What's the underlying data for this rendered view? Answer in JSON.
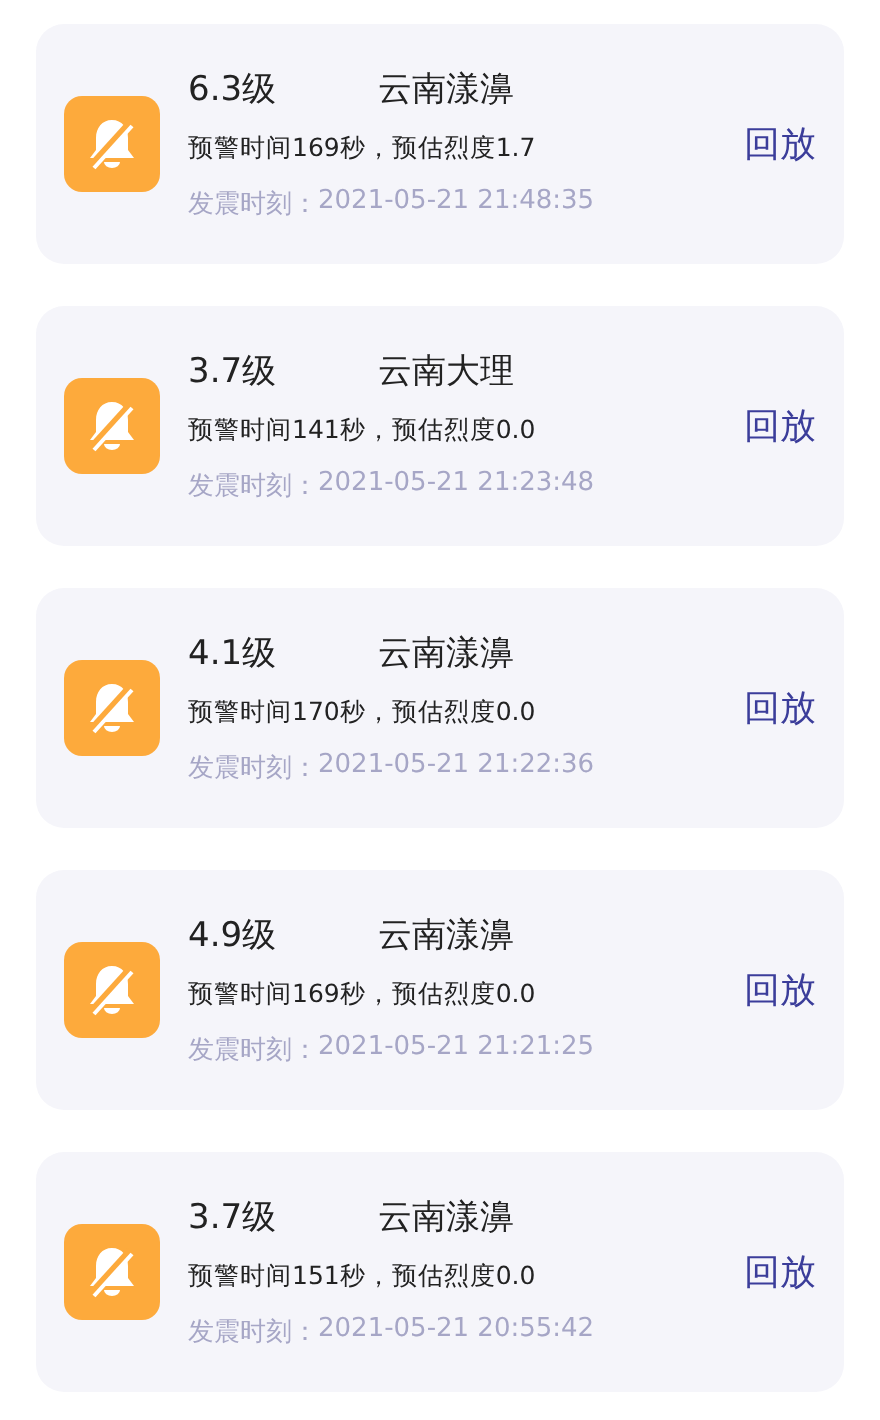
{
  "events": [
    {
      "magnitude": "6.3级",
      "place": "云南漾濞",
      "warning": "预警时间169秒，预估烈度1.7",
      "time_label": "发震时刻：",
      "time": "2021-05-21 21:48:35",
      "action": "回放"
    },
    {
      "magnitude": "3.7级",
      "place": "云南大理",
      "warning": "预警时间141秒，预估烈度0.0",
      "time_label": "发震时刻：",
      "time": "2021-05-21 21:23:48",
      "action": "回放"
    },
    {
      "magnitude": "4.1级",
      "place": "云南漾濞",
      "warning": "预警时间170秒，预估烈度0.0",
      "time_label": "发震时刻：",
      "time": "2021-05-21 21:22:36",
      "action": "回放"
    },
    {
      "magnitude": "4.9级",
      "place": "云南漾濞",
      "warning": "预警时间169秒，预估烈度0.0",
      "time_label": "发震时刻：",
      "time": "2021-05-21 21:21:25",
      "action": "回放"
    },
    {
      "magnitude": "3.7级",
      "place": "云南漾濞",
      "warning": "预警时间151秒，预估烈度0.0",
      "time_label": "发震时刻：",
      "time": "2021-05-21 20:55:42",
      "action": "回放"
    }
  ]
}
